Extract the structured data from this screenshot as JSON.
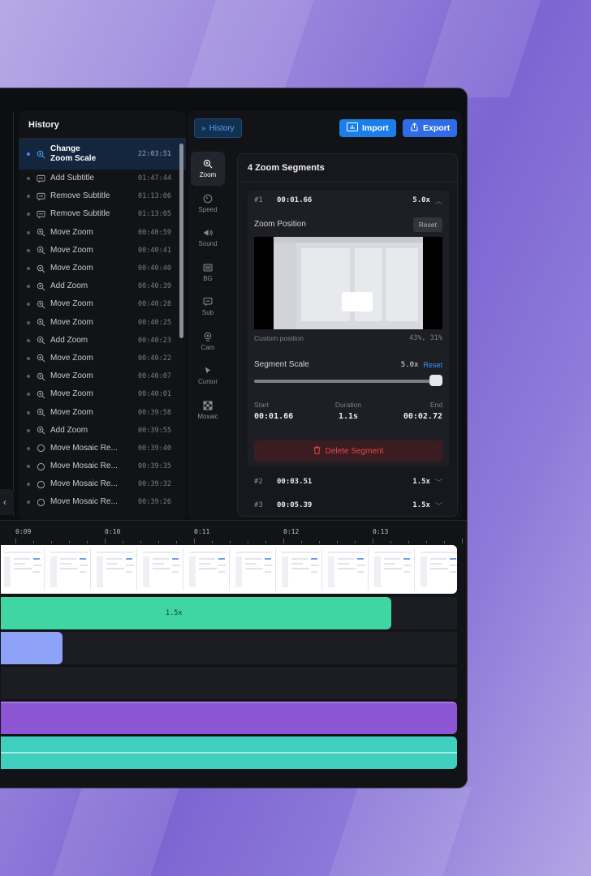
{
  "history": {
    "title": "History",
    "items": [
      {
        "label": "Change\nZoom Scale",
        "time": "22:03:51",
        "icon": "zoom-icon",
        "active": true
      },
      {
        "label": "Add Subtitle",
        "time": "01:47:44",
        "icon": "subtitle-icon"
      },
      {
        "label": "Remove Subtitle",
        "time": "01:13:06",
        "icon": "subtitle-icon"
      },
      {
        "label": "Remove Subtitle",
        "time": "01:13:05",
        "icon": "subtitle-icon"
      },
      {
        "label": "Move Zoom",
        "time": "00:40:59",
        "icon": "zoom-icon"
      },
      {
        "label": "Move Zoom",
        "time": "00:40:41",
        "icon": "zoom-icon"
      },
      {
        "label": "Move Zoom",
        "time": "00:40:40",
        "icon": "zoom-icon"
      },
      {
        "label": "Add Zoom",
        "time": "00:40:39",
        "icon": "zoom-icon"
      },
      {
        "label": "Move Zoom",
        "time": "00:40:28",
        "icon": "zoom-icon"
      },
      {
        "label": "Move Zoom",
        "time": "00:40:25",
        "icon": "zoom-icon"
      },
      {
        "label": "Add Zoom",
        "time": "00:40:23",
        "icon": "zoom-icon"
      },
      {
        "label": "Move Zoom",
        "time": "00:40:22",
        "icon": "zoom-icon"
      },
      {
        "label": "Move Zoom",
        "time": "00:40:07",
        "icon": "zoom-icon"
      },
      {
        "label": "Move Zoom",
        "time": "00:40:01",
        "icon": "zoom-icon"
      },
      {
        "label": "Move Zoom",
        "time": "00:39:58",
        "icon": "zoom-icon"
      },
      {
        "label": "Add Zoom",
        "time": "00:39:55",
        "icon": "zoom-icon"
      },
      {
        "label": "Move Mosaic Re...",
        "time": "00:39:40",
        "icon": "circle-icon"
      },
      {
        "label": "Move Mosaic Re...",
        "time": "00:39:35",
        "icon": "circle-icon"
      },
      {
        "label": "Move Mosaic Re...",
        "time": "00:39:32",
        "icon": "circle-icon"
      },
      {
        "label": "Move Mosaic Re...",
        "time": "00:39:26",
        "icon": "circle-icon"
      }
    ]
  },
  "toolbar": {
    "history_label": "History",
    "import_label": "Import",
    "export_label": "Export"
  },
  "tools": [
    {
      "label": "Zoom",
      "icon": "zoom-icon",
      "active": true
    },
    {
      "label": "Speed",
      "icon": "speed-icon"
    },
    {
      "label": "Sound",
      "icon": "sound-icon"
    },
    {
      "label": "BG",
      "icon": "background-icon"
    },
    {
      "label": "Sub",
      "icon": "subtitle-icon"
    },
    {
      "label": "Cam",
      "icon": "camera-icon"
    },
    {
      "label": "Cursor",
      "icon": "cursor-icon"
    },
    {
      "label": "Mosaic",
      "icon": "mosaic-icon"
    }
  ],
  "zoom_panel": {
    "title": "4 Zoom Segments",
    "segment": {
      "num": "#1",
      "time": "00:01.66",
      "scale": "5.0x",
      "position_label": "Zoom Position",
      "reset_label": "Reset",
      "custom_label": "Custom position",
      "custom_value": "43%, 31%",
      "scale_label": "Segment Scale",
      "scale_value": "5.0x",
      "scale_reset": "Reset",
      "scale_level": 1.0,
      "start_label": "Start",
      "start_value": "00:01.66",
      "duration_label": "Duration",
      "duration_value": "1.1s",
      "end_label": "End",
      "end_value": "00:02.72",
      "delete_label": "Delete Segment"
    },
    "others": [
      {
        "num": "#2",
        "time": "00:03.51",
        "scale": "1.5x"
      },
      {
        "num": "#3",
        "time": "00:05.39",
        "scale": "1.5x"
      }
    ]
  },
  "timeline": {
    "ticks": [
      "0:09",
      "0:10",
      "0:11",
      "0:12",
      "0:13"
    ],
    "zoom_bar_label": "1.5x",
    "colors": {
      "zoom": "#3fd6a4",
      "speed": "#8ea2f7",
      "purple": "#8b55d4",
      "teal": "#3fcfbe"
    }
  },
  "accent": "#2f6de8"
}
